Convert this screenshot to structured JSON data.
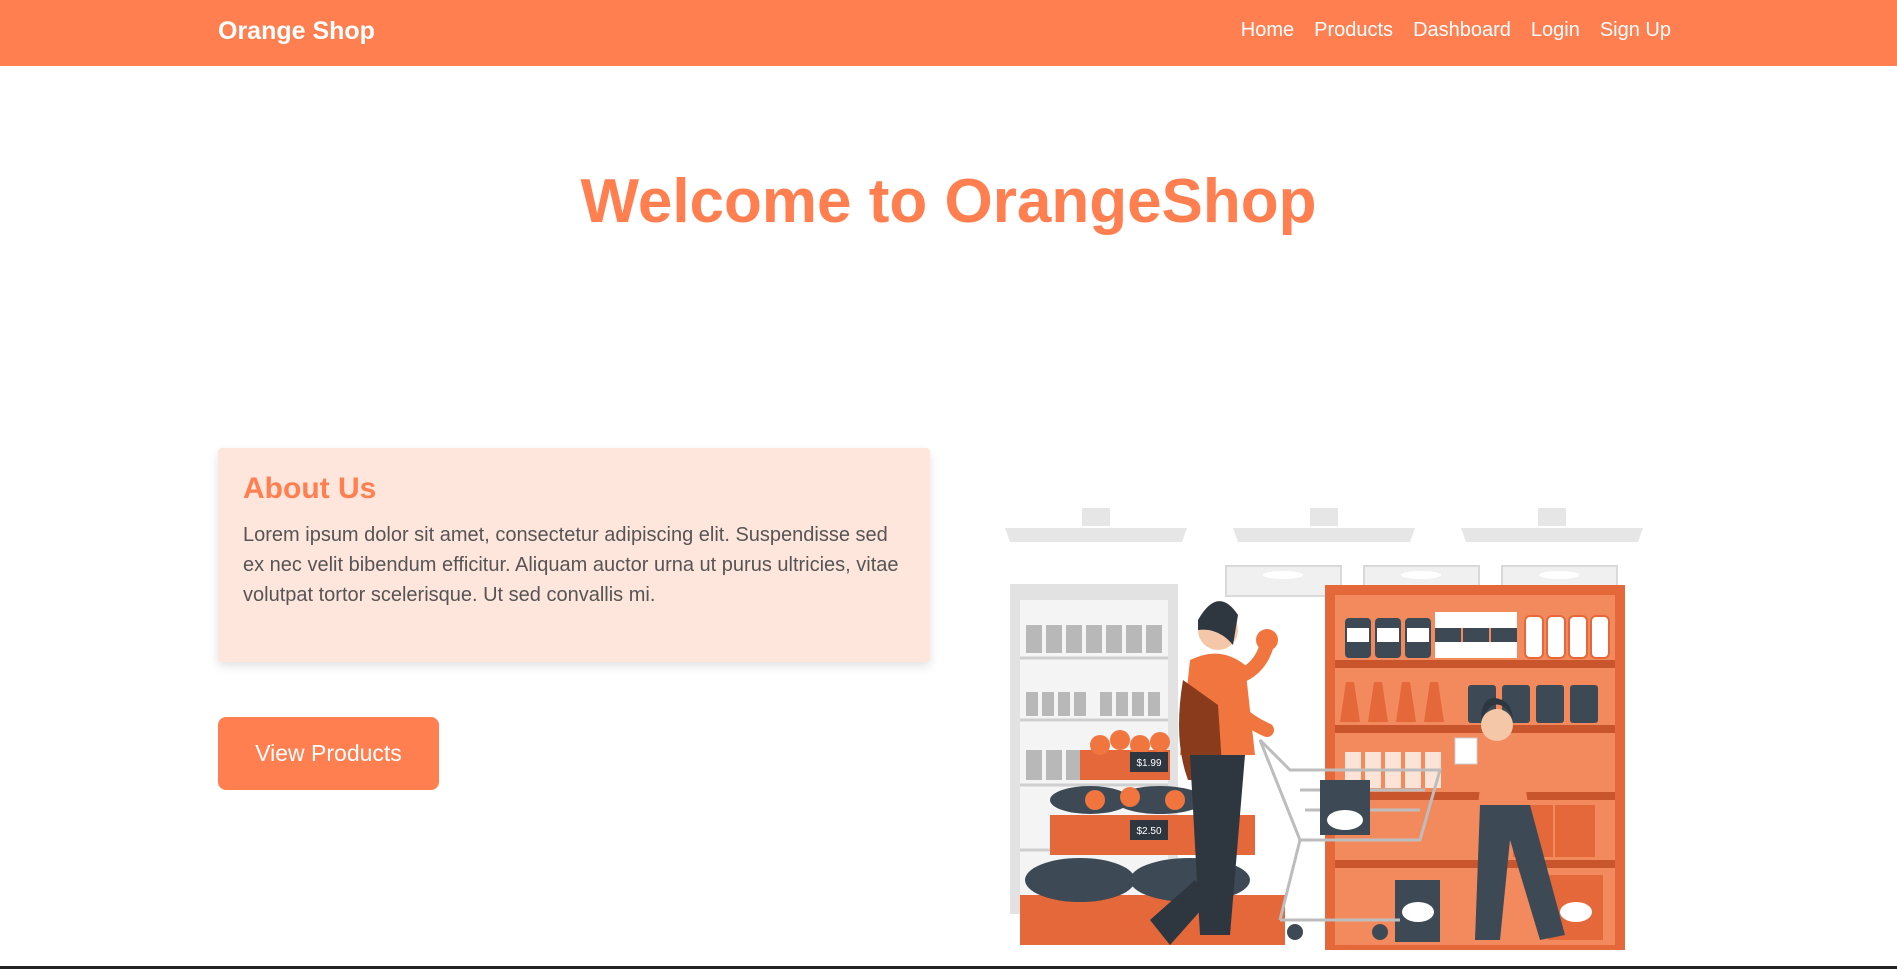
{
  "navbar": {
    "brand": "Orange Shop",
    "links": [
      "Home",
      "Products",
      "Dashboard",
      "Login",
      "Sign Up"
    ]
  },
  "hero": {
    "title": "Welcome to OrangeShop"
  },
  "about": {
    "heading": "About Us",
    "text": "Lorem ipsum dolor sit amet, consectetur adipiscing elit. Suspendisse sed ex nec velit bibendum efficitur. Aliquam auctor urna ut purus ultricies, vitae volutpat tortor scelerisque. Ut sed convallis mi."
  },
  "cta": {
    "label": "View Products"
  },
  "illustration": {
    "price_tags": [
      "$1.99",
      "$2.50"
    ]
  },
  "colors": {
    "primary": "#ff7f50",
    "card_bg": "#ffe6dc",
    "dark": "#3d4a55"
  }
}
